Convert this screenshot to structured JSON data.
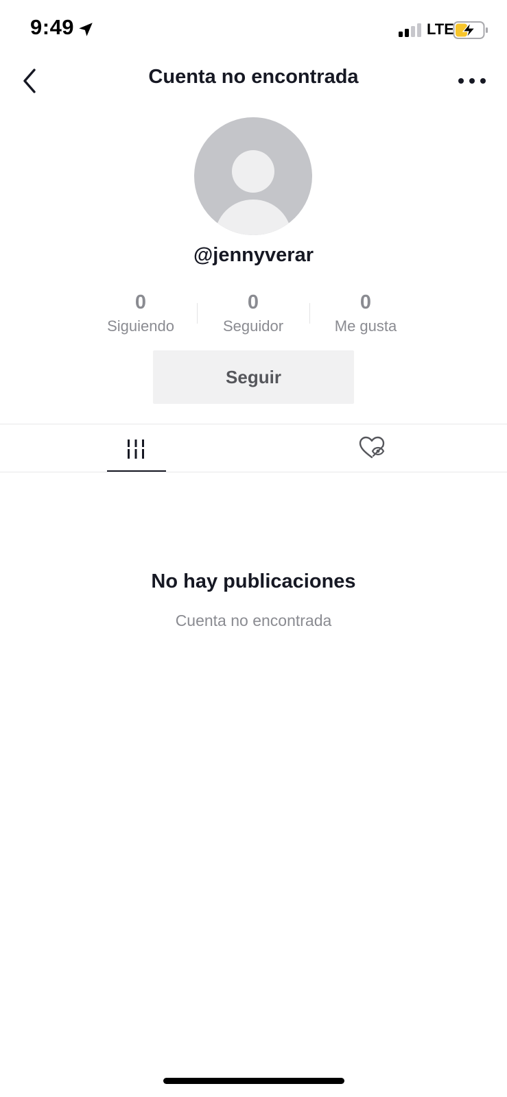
{
  "status_bar": {
    "time": "9:49",
    "network": "LTE",
    "icons": [
      "location-arrow-icon",
      "signal-icon",
      "battery-charging-icon"
    ],
    "battery_color": "#f7c52b"
  },
  "header": {
    "title": "Cuenta no encontrada",
    "icons": [
      "chevron-left-icon",
      "more-dots-icon"
    ]
  },
  "profile": {
    "avatar": "default-avatar-icon",
    "username": "@jennyverar",
    "stats": [
      {
        "value": "0",
        "label": "Siguiendo"
      },
      {
        "value": "0",
        "label": "Seguidor"
      },
      {
        "value": "0",
        "label": "Me gusta"
      }
    ],
    "follow_label": "Seguir"
  },
  "tabs": [
    {
      "icon": "grid-icon",
      "active": true
    },
    {
      "icon": "liked-hidden-heart-icon",
      "active": false
    }
  ],
  "empty_state": {
    "title": "No hay publicaciones",
    "subtitle": "Cuenta no encontrada"
  },
  "colors": {
    "text_primary": "#161823",
    "text_secondary": "#8a8b91",
    "button_bg": "#f1f1f2",
    "avatar_bg": "#c4c5c9"
  }
}
